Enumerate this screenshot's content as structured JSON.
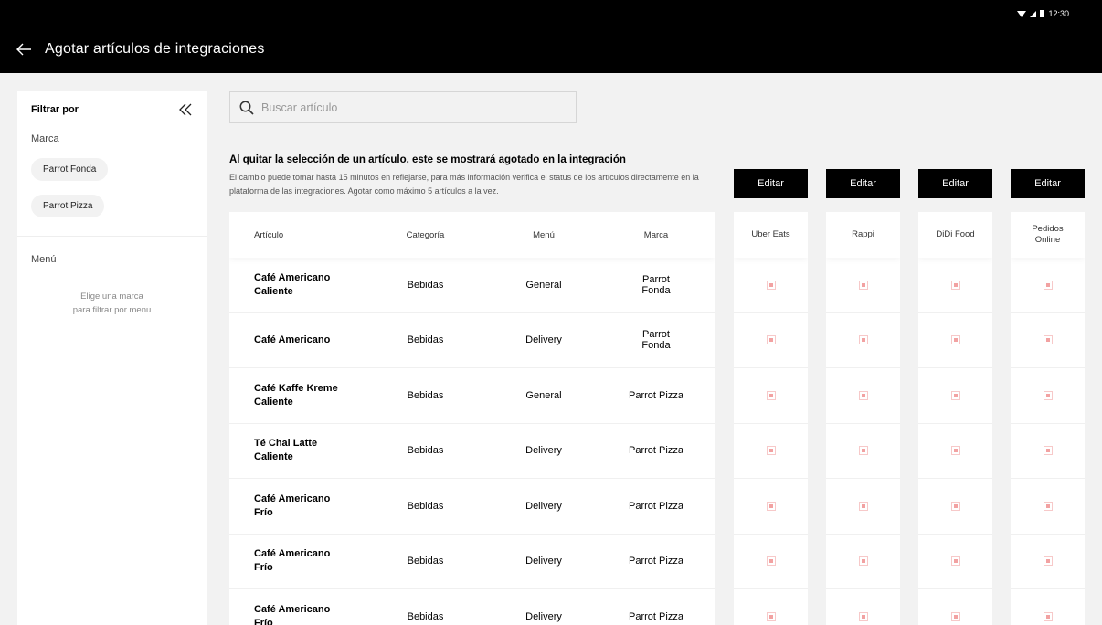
{
  "status": {
    "time": "12:30"
  },
  "header": {
    "title": "Agotar artículos de integraciones"
  },
  "sidebar": {
    "filter_title": "Filtrar por",
    "brand_label": "Marca",
    "brands": [
      "Parrot Fonda",
      "Parrot Pizza"
    ],
    "menu_label": "Menú",
    "menu_hint_line1": "Elige una marca",
    "menu_hint_line2": "para filtrar por menu"
  },
  "search": {
    "placeholder": "Buscar artículo",
    "value": ""
  },
  "info": {
    "title": "Al quitar la selección de un artículo, este se mostrará agotado en la integración",
    "desc": "El cambio puede tomar hasta 15 minutos en reflejarse, para más información verifica el status de los artículos directamente en la plataforma de las integraciones. Agotar como máximo 5 artículos a la vez."
  },
  "table": {
    "headers": {
      "article": "Artículo",
      "category": "Categoría",
      "menu": "Menú",
      "brand": "Marca"
    },
    "rows": [
      {
        "article_l1": "Café Americano",
        "article_l2": "Caliente",
        "category": "Bebidas",
        "menu": "General",
        "brand": "Parrot Fonda"
      },
      {
        "article_l1": "Café Americano",
        "article_l2": "",
        "category": "Bebidas",
        "menu": "Delivery",
        "brand": "Parrot Fonda"
      },
      {
        "article_l1": "Café Kaffe Kreme",
        "article_l2": "Caliente",
        "category": "Bebidas",
        "menu": "General",
        "brand": "Parrot Pizza"
      },
      {
        "article_l1": "Té Chai Latte",
        "article_l2": "Caliente",
        "category": "Bebidas",
        "menu": "Delivery",
        "brand": "Parrot Pizza"
      },
      {
        "article_l1": "Café Americano",
        "article_l2": "Frío",
        "category": "Bebidas",
        "menu": "Delivery",
        "brand": "Parrot Pizza"
      },
      {
        "article_l1": "Café Americano",
        "article_l2": "Frío",
        "category": "Bebidas",
        "menu": "Delivery",
        "brand": "Parrot Pizza"
      },
      {
        "article_l1": "Café Americano",
        "article_l2": "Frío",
        "category": "Bebidas",
        "menu": "Delivery",
        "brand": "Parrot Pizza"
      }
    ]
  },
  "integrations": [
    {
      "edit_label": "Editar",
      "name_l1": "Uber Eats",
      "name_l2": ""
    },
    {
      "edit_label": "Editar",
      "name_l1": "Rappi",
      "name_l2": ""
    },
    {
      "edit_label": "Editar",
      "name_l1": "DiDi Food",
      "name_l2": ""
    },
    {
      "edit_label": "Editar",
      "name_l1": "Pedidos",
      "name_l2": "Online"
    }
  ],
  "colors": {
    "appbar": "#000000",
    "background": "#f2f2f2",
    "checkbox": "#f2a2a2"
  },
  "icons": {
    "back": "arrow-left-icon",
    "collapse": "double-chevron-left-icon",
    "search": "search-icon"
  }
}
